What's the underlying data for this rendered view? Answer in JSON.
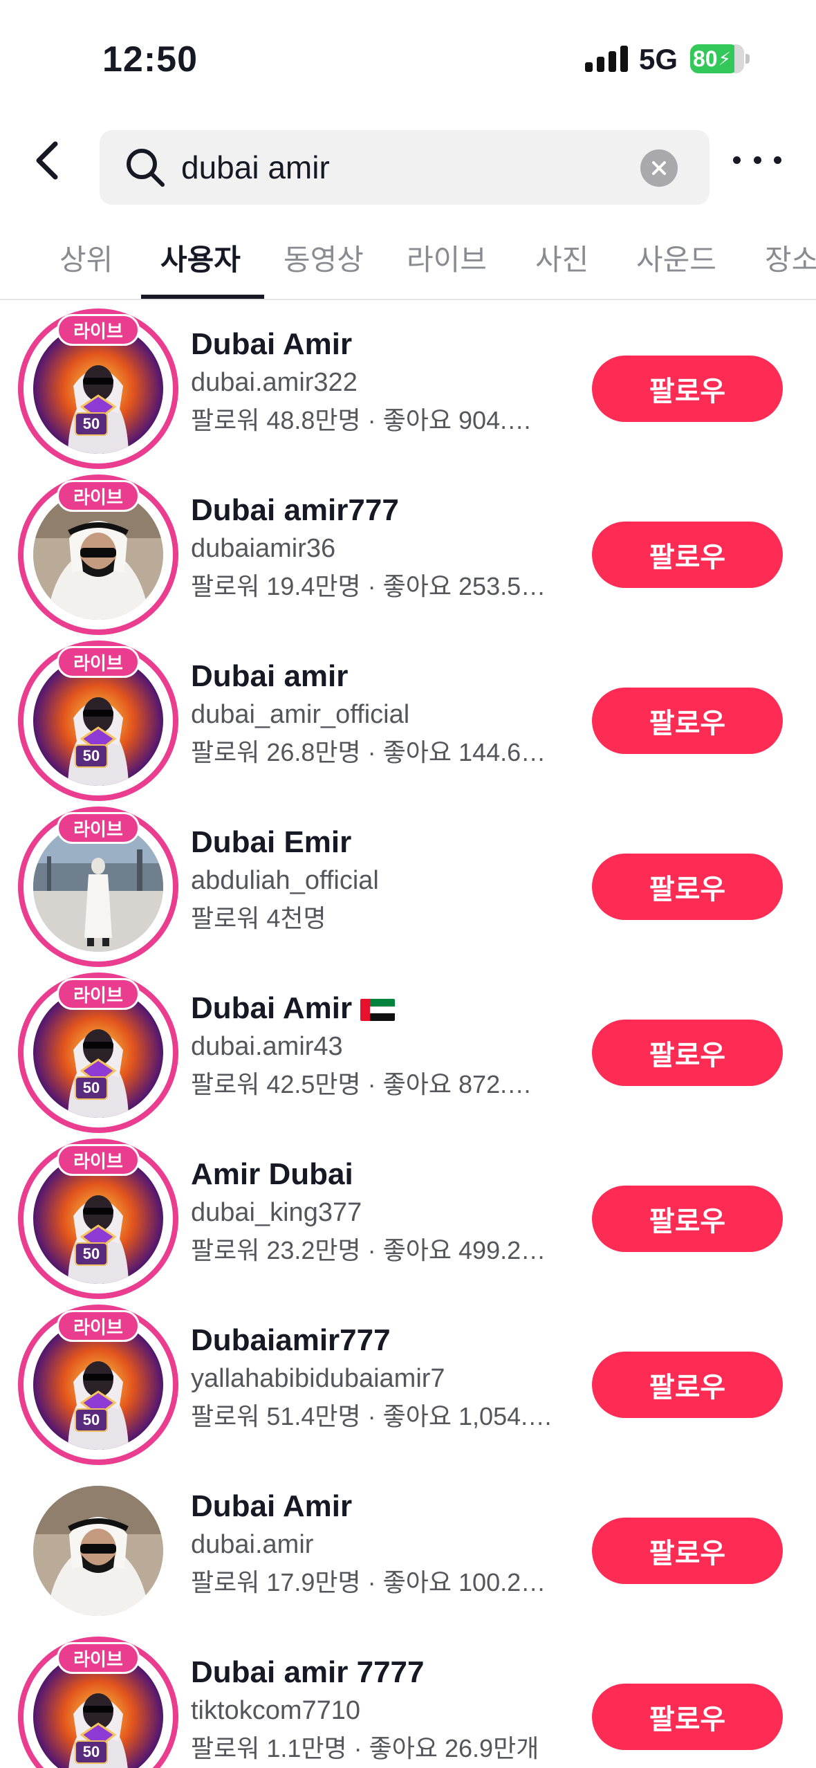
{
  "status_bar": {
    "time": "12:50",
    "network": "5G",
    "battery": "80"
  },
  "search": {
    "query": "dubai amir",
    "back_icon": "chevron-left-icon",
    "search_icon": "magnifier-icon",
    "clear_icon": "close-circle-icon",
    "more_icon": "ellipsis-icon"
  },
  "tabs": [
    {
      "label": "상위"
    },
    {
      "label": "사용자"
    },
    {
      "label": "동영상"
    },
    {
      "label": "라이브"
    },
    {
      "label": "사진"
    },
    {
      "label": "사운드"
    },
    {
      "label": "장소"
    }
  ],
  "active_tab": "사용자",
  "follow_label": "팔로우",
  "live_label": "라이브",
  "level_label": "50",
  "colors": {
    "accent": "#fe2c55",
    "live_ring": "#ea3d8f",
    "battery": "#34c759"
  },
  "users": [
    {
      "name": "Dubai Amir",
      "handle": "dubai.amir322",
      "stats": "팔로워 48.8만명 · 좋아요 904.…",
      "live": true,
      "flag": false
    },
    {
      "name": "Dubai amir777",
      "handle": "dubaiamir36",
      "stats": "팔로워 19.4만명 · 좋아요 253.5…",
      "live": true,
      "flag": false
    },
    {
      "name": "Dubai amir",
      "handle": "dubai_amir_official",
      "stats": "팔로워 26.8만명 · 좋아요 144.6…",
      "live": true,
      "flag": false
    },
    {
      "name": "Dubai Emir",
      "handle": "abduliah_official",
      "stats": "팔로워 4천명",
      "live": true,
      "flag": false
    },
    {
      "name": "Dubai Amir",
      "handle": "dubai.amir43",
      "stats": "팔로워 42.5만명 · 좋아요 872.…",
      "live": true,
      "flag": true
    },
    {
      "name": "Amir Dubai",
      "handle": "dubai_king377",
      "stats": "팔로워 23.2만명 · 좋아요 499.2…",
      "live": true,
      "flag": false
    },
    {
      "name": "Dubaiamir777",
      "handle": "yallahabibidubaiamir7",
      "stats": "팔로워 51.4만명 · 좋아요 1,054.…",
      "live": true,
      "flag": false
    },
    {
      "name": "Dubai Amir",
      "handle": "dubai.amir",
      "stats": "팔로워 17.9만명 · 좋아요 100.2…",
      "live": false,
      "flag": false
    },
    {
      "name": "Dubai amir 7777",
      "handle": "tiktokcom7710",
      "stats": "팔로워 1.1만명 · 좋아요 26.9만개",
      "live": true,
      "flag": false
    }
  ]
}
